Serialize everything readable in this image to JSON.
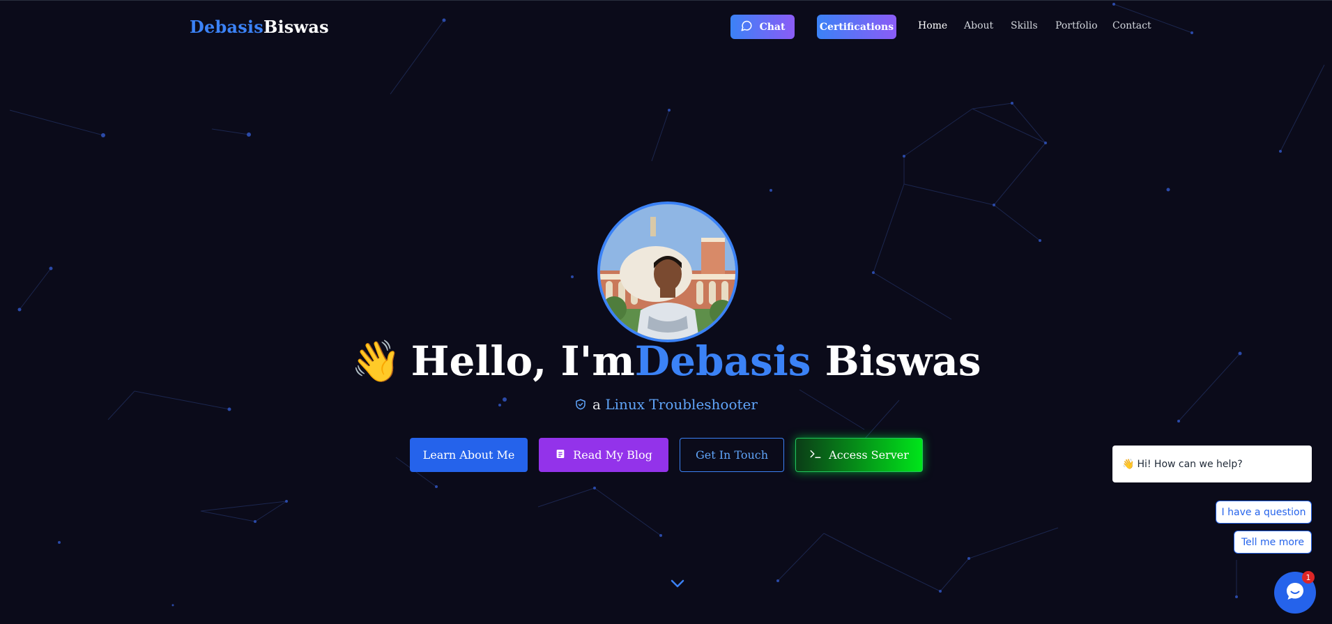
{
  "header": {
    "logo_first": "Debasis",
    "logo_last": "Biswas",
    "chat_label": "Chat",
    "certifications_label": "Certifications",
    "nav": [
      "Home",
      "About",
      "Skills",
      "Portfolio",
      "Contact"
    ],
    "active_nav": "Home"
  },
  "hero": {
    "wave_emoji": "👋",
    "title_prefix": "Hello, I'm",
    "title_highlight": "Debasis",
    "title_suffix": " Biswas",
    "subtitle_prefix": "a",
    "subtitle_role": "Linux Troubleshooter",
    "buttons": {
      "learn": "Learn About Me",
      "blog": "Read My Blog",
      "touch": "Get In Touch",
      "server": "Access Server"
    }
  },
  "chat_widget": {
    "greeting_emoji": "👋",
    "greeting": "Hi! How can we help?",
    "option_1": "I have a question",
    "option_2": "Tell me more",
    "badge_count": "1"
  },
  "icons": {
    "chat_button": "chat-bubble-icon",
    "shield": "shield-check-icon",
    "blog": "document-icon",
    "server": "terminal-icon",
    "scroll": "chevron-down-icon",
    "launcher": "chat-icon"
  },
  "colors": {
    "background": "#0b0b1a",
    "accent_blue": "#3b82f6",
    "purple": "#9333ea",
    "server_green": "#00e51a",
    "badge_red": "#dc2626"
  }
}
